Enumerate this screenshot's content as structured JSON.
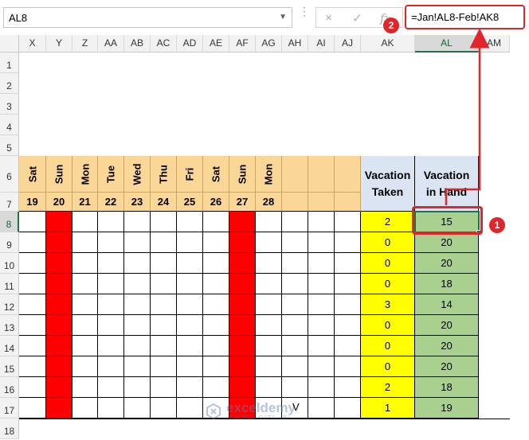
{
  "formula_bar": {
    "name_box": "AL8",
    "formula": "=Jan!AL8-Feb!AK8",
    "cancel_icon": "×",
    "enter_icon": "✓",
    "fx_label": "fx"
  },
  "columns": [
    "X",
    "Y",
    "Z",
    "AA",
    "AB",
    "AC",
    "AD",
    "AE",
    "AF",
    "AG",
    "AH",
    "AI",
    "AJ",
    "AK",
    "AL",
    "AM"
  ],
  "rows": [
    "1",
    "2",
    "3",
    "4",
    "5",
    "6",
    "7",
    "8",
    "9",
    "10",
    "11",
    "12",
    "13",
    "14",
    "15",
    "16",
    "17",
    "18"
  ],
  "sheet": {
    "day_names": [
      "Sat",
      "Sun",
      "Mon",
      "Tue",
      "Wed",
      "Thu",
      "Fri",
      "Sat",
      "Sun",
      "Mon"
    ],
    "dates": [
      "19",
      "20",
      "21",
      "22",
      "23",
      "24",
      "25",
      "26",
      "27",
      "28"
    ],
    "vacation_taken_header": [
      "Vacation",
      "Taken"
    ],
    "vacation_in_hand_header": [
      "Vacation",
      "in Hand"
    ],
    "vacation_taken": [
      "2",
      "0",
      "0",
      "0",
      "3",
      "0",
      "0",
      "0",
      "2",
      "1"
    ],
    "vacation_in_hand": [
      "15",
      "20",
      "20",
      "18",
      "14",
      "20",
      "20",
      "20",
      "18",
      "19"
    ],
    "stray_text": "V"
  },
  "callouts": [
    "1",
    "2"
  ],
  "watermark": {
    "name": "exceldemy",
    "tagline": "EXCEL · DATA · BI"
  },
  "colors": {
    "accent": "#e0262a",
    "header_fill": "#fad797",
    "sunday": "#ff0000",
    "taken": "#ffff00",
    "in_hand": "#a9d08e",
    "selection": "#217346"
  }
}
